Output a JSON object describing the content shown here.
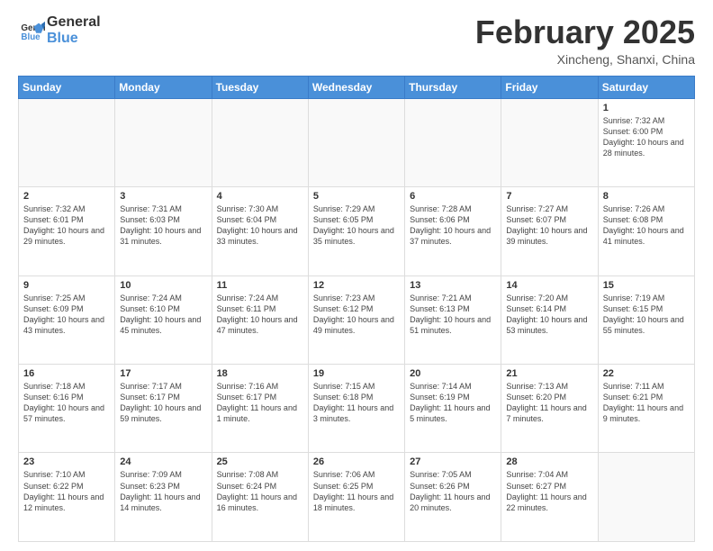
{
  "logo": {
    "line1": "General",
    "line2": "Blue"
  },
  "title": "February 2025",
  "location": "Xincheng, Shanxi, China",
  "weekdays": [
    "Sunday",
    "Monday",
    "Tuesday",
    "Wednesday",
    "Thursday",
    "Friday",
    "Saturday"
  ],
  "weeks": [
    [
      {
        "day": "",
        "info": ""
      },
      {
        "day": "",
        "info": ""
      },
      {
        "day": "",
        "info": ""
      },
      {
        "day": "",
        "info": ""
      },
      {
        "day": "",
        "info": ""
      },
      {
        "day": "",
        "info": ""
      },
      {
        "day": "1",
        "info": "Sunrise: 7:32 AM\nSunset: 6:00 PM\nDaylight: 10 hours and 28 minutes."
      }
    ],
    [
      {
        "day": "2",
        "info": "Sunrise: 7:32 AM\nSunset: 6:01 PM\nDaylight: 10 hours and 29 minutes."
      },
      {
        "day": "3",
        "info": "Sunrise: 7:31 AM\nSunset: 6:03 PM\nDaylight: 10 hours and 31 minutes."
      },
      {
        "day": "4",
        "info": "Sunrise: 7:30 AM\nSunset: 6:04 PM\nDaylight: 10 hours and 33 minutes."
      },
      {
        "day": "5",
        "info": "Sunrise: 7:29 AM\nSunset: 6:05 PM\nDaylight: 10 hours and 35 minutes."
      },
      {
        "day": "6",
        "info": "Sunrise: 7:28 AM\nSunset: 6:06 PM\nDaylight: 10 hours and 37 minutes."
      },
      {
        "day": "7",
        "info": "Sunrise: 7:27 AM\nSunset: 6:07 PM\nDaylight: 10 hours and 39 minutes."
      },
      {
        "day": "8",
        "info": "Sunrise: 7:26 AM\nSunset: 6:08 PM\nDaylight: 10 hours and 41 minutes."
      }
    ],
    [
      {
        "day": "9",
        "info": "Sunrise: 7:25 AM\nSunset: 6:09 PM\nDaylight: 10 hours and 43 minutes."
      },
      {
        "day": "10",
        "info": "Sunrise: 7:24 AM\nSunset: 6:10 PM\nDaylight: 10 hours and 45 minutes."
      },
      {
        "day": "11",
        "info": "Sunrise: 7:24 AM\nSunset: 6:11 PM\nDaylight: 10 hours and 47 minutes."
      },
      {
        "day": "12",
        "info": "Sunrise: 7:23 AM\nSunset: 6:12 PM\nDaylight: 10 hours and 49 minutes."
      },
      {
        "day": "13",
        "info": "Sunrise: 7:21 AM\nSunset: 6:13 PM\nDaylight: 10 hours and 51 minutes."
      },
      {
        "day": "14",
        "info": "Sunrise: 7:20 AM\nSunset: 6:14 PM\nDaylight: 10 hours and 53 minutes."
      },
      {
        "day": "15",
        "info": "Sunrise: 7:19 AM\nSunset: 6:15 PM\nDaylight: 10 hours and 55 minutes."
      }
    ],
    [
      {
        "day": "16",
        "info": "Sunrise: 7:18 AM\nSunset: 6:16 PM\nDaylight: 10 hours and 57 minutes."
      },
      {
        "day": "17",
        "info": "Sunrise: 7:17 AM\nSunset: 6:17 PM\nDaylight: 10 hours and 59 minutes."
      },
      {
        "day": "18",
        "info": "Sunrise: 7:16 AM\nSunset: 6:17 PM\nDaylight: 11 hours and 1 minute."
      },
      {
        "day": "19",
        "info": "Sunrise: 7:15 AM\nSunset: 6:18 PM\nDaylight: 11 hours and 3 minutes."
      },
      {
        "day": "20",
        "info": "Sunrise: 7:14 AM\nSunset: 6:19 PM\nDaylight: 11 hours and 5 minutes."
      },
      {
        "day": "21",
        "info": "Sunrise: 7:13 AM\nSunset: 6:20 PM\nDaylight: 11 hours and 7 minutes."
      },
      {
        "day": "22",
        "info": "Sunrise: 7:11 AM\nSunset: 6:21 PM\nDaylight: 11 hours and 9 minutes."
      }
    ],
    [
      {
        "day": "23",
        "info": "Sunrise: 7:10 AM\nSunset: 6:22 PM\nDaylight: 11 hours and 12 minutes."
      },
      {
        "day": "24",
        "info": "Sunrise: 7:09 AM\nSunset: 6:23 PM\nDaylight: 11 hours and 14 minutes."
      },
      {
        "day": "25",
        "info": "Sunrise: 7:08 AM\nSunset: 6:24 PM\nDaylight: 11 hours and 16 minutes."
      },
      {
        "day": "26",
        "info": "Sunrise: 7:06 AM\nSunset: 6:25 PM\nDaylight: 11 hours and 18 minutes."
      },
      {
        "day": "27",
        "info": "Sunrise: 7:05 AM\nSunset: 6:26 PM\nDaylight: 11 hours and 20 minutes."
      },
      {
        "day": "28",
        "info": "Sunrise: 7:04 AM\nSunset: 6:27 PM\nDaylight: 11 hours and 22 minutes."
      },
      {
        "day": "",
        "info": ""
      }
    ]
  ]
}
